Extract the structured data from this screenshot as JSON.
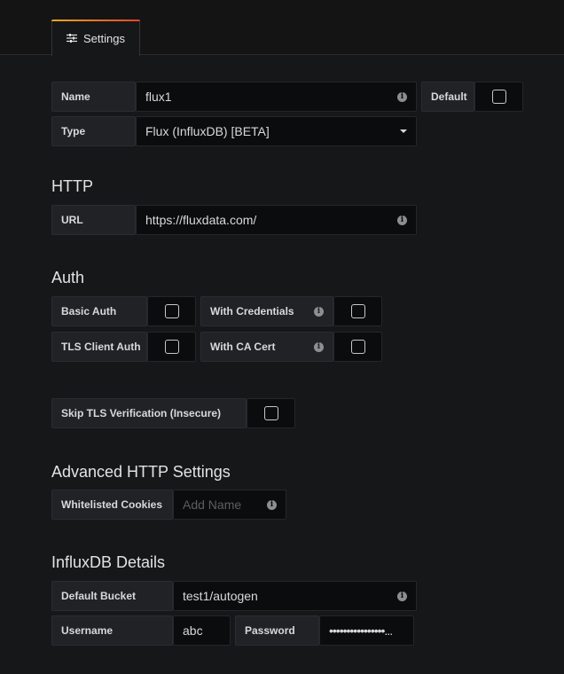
{
  "tabs": {
    "settings_label": "Settings"
  },
  "basic": {
    "name_label": "Name",
    "name_value": "flux1",
    "default_label": "Default",
    "type_label": "Type",
    "type_value": "Flux (InfluxDB) [BETA]"
  },
  "http": {
    "title": "HTTP",
    "url_label": "URL",
    "url_value": "https://fluxdata.com/"
  },
  "auth": {
    "title": "Auth",
    "basic_auth_label": "Basic Auth",
    "with_credentials_label": "With Credentials",
    "tls_client_auth_label": "TLS Client Auth",
    "with_ca_cert_label": "With CA Cert",
    "skip_tls_label": "Skip TLS Verification (Insecure)"
  },
  "advanced_http": {
    "title": "Advanced HTTP Settings",
    "whitelisted_cookies_label": "Whitelisted Cookies",
    "cookies_placeholder": "Add Name"
  },
  "influxdb": {
    "title": "InfluxDB Details",
    "default_bucket_label": "Default Bucket",
    "default_bucket_value": "test1/autogen",
    "username_label": "Username",
    "username_value": "abc",
    "password_label": "Password",
    "password_value": "••••••••••••••••..."
  },
  "icons": {
    "settings_tab": "sliders-icon",
    "info": "info-icon",
    "dropdown": "caret-down-icon"
  }
}
